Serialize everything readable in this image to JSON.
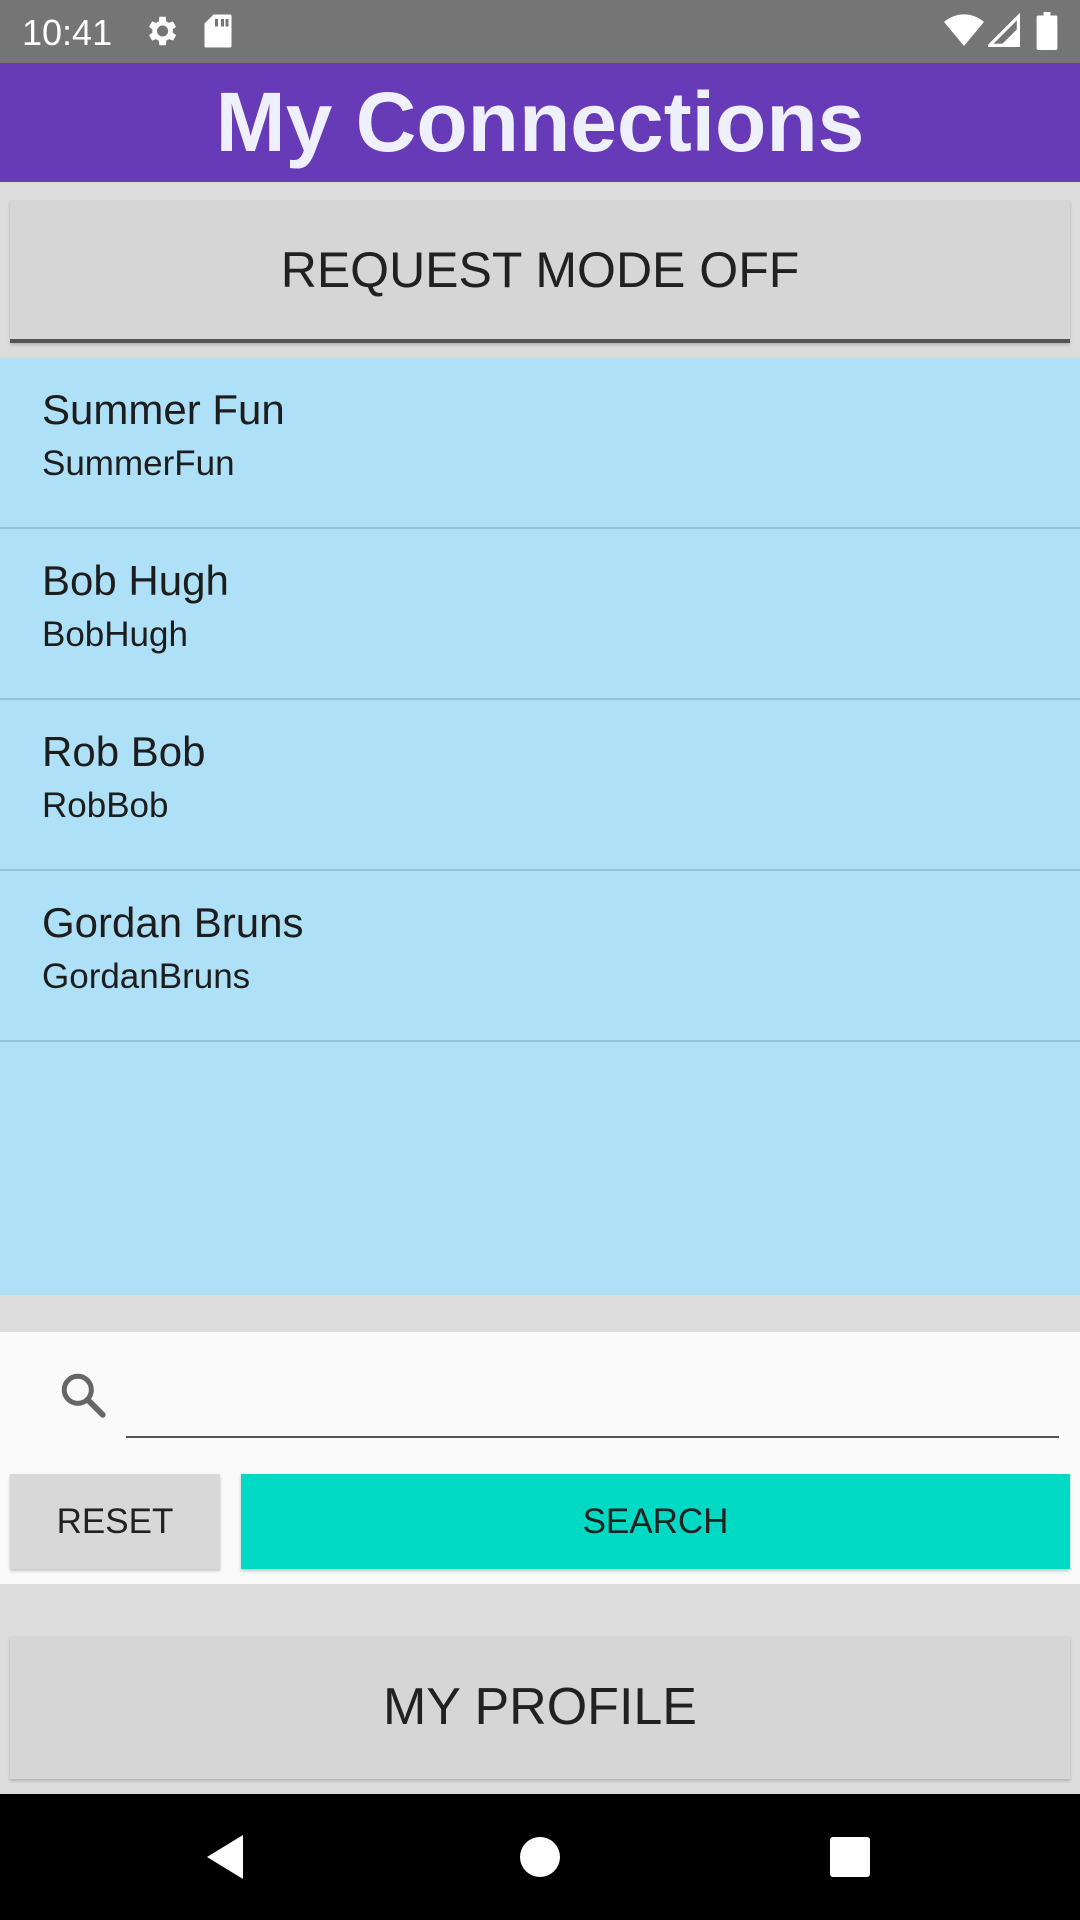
{
  "status_bar": {
    "time": "10:41",
    "icons": [
      "settings-icon",
      "sd-card-icon",
      "wifi-icon",
      "cell-signal-icon",
      "battery-icon"
    ]
  },
  "header": {
    "title": "My Connections",
    "color": "#673ab7"
  },
  "request_mode": {
    "label": "REQUEST MODE OFF"
  },
  "connections": [
    {
      "name": "Summer Fun",
      "username": "SummerFun"
    },
    {
      "name": "Bob Hugh",
      "username": "BobHugh"
    },
    {
      "name": "Rob Bob",
      "username": "RobBob"
    },
    {
      "name": "Gordan Bruns",
      "username": "GordanBruns"
    }
  ],
  "search": {
    "value": "",
    "placeholder": "",
    "reset_label": "RESET",
    "search_label": "SEARCH",
    "search_color": "#00d9c3"
  },
  "profile": {
    "label": "MY PROFILE"
  },
  "nav": {
    "icons": [
      "back-icon",
      "home-icon",
      "recents-icon"
    ]
  },
  "colors": {
    "list_background": "#aee0f7",
    "status_bar": "#757575"
  }
}
